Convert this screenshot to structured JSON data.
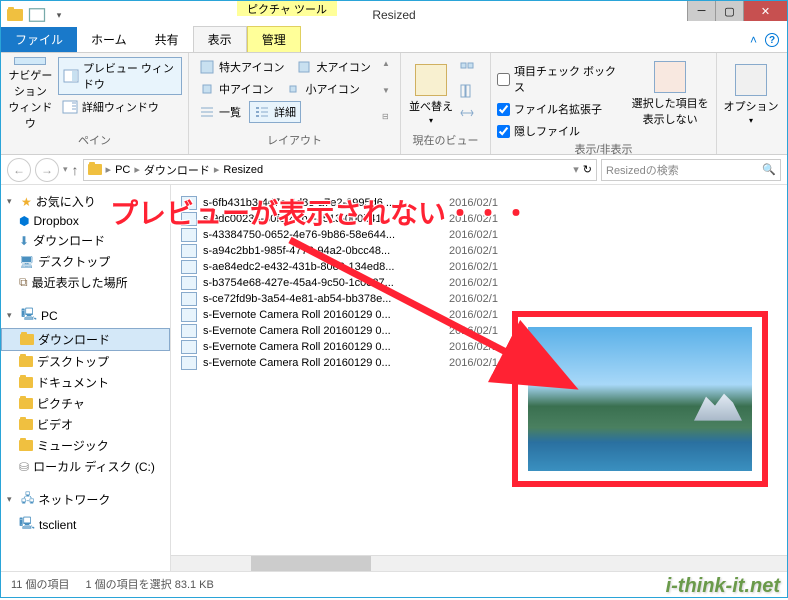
{
  "window": {
    "title": "Resized",
    "context_tab": "ピクチャ ツール"
  },
  "ribbon_tabs": {
    "file": "ファイル",
    "home": "ホーム",
    "share": "共有",
    "view": "表示",
    "manage": "管理"
  },
  "ribbon": {
    "pane": {
      "nav_window": "ナビゲーション\nウィンドウ",
      "preview_window": "プレビュー ウィンドウ",
      "details_window": "詳細ウィンドウ",
      "label": "ペイン"
    },
    "layout": {
      "extra_large": "特大アイコン",
      "large": "大アイコン",
      "medium": "中アイコン",
      "small": "小アイコン",
      "list": "一覧",
      "details": "詳細",
      "label": "レイアウト"
    },
    "current_view": {
      "sort": "並べ替え",
      "label": "現在のビュー"
    },
    "show_hide": {
      "item_checkbox": "項目チェック ボックス",
      "file_ext": "ファイル名拡張子",
      "hidden_files": "隠しファイル",
      "hide_selected": "選択した項目を\n表示しない",
      "label": "表示/非表示"
    },
    "options": {
      "btn": "オプション"
    }
  },
  "breadcrumb": {
    "parts": [
      "PC",
      "ダウンロード",
      "Resized"
    ],
    "refresh": "↻"
  },
  "search": {
    "placeholder": "Resizedの検索"
  },
  "tree": {
    "favorites": "お気に入り",
    "dropbox": "Dropbox",
    "downloads": "ダウンロード",
    "desktop": "デスクトップ",
    "recent": "最近表示した場所",
    "pc": "PC",
    "pc_downloads": "ダウンロード",
    "pc_desktop": "デスクトップ",
    "documents": "ドキュメント",
    "pictures": "ピクチャ",
    "videos": "ビデオ",
    "music": "ミュージック",
    "local_disk": "ローカル ディスク (C:)",
    "network": "ネットワーク",
    "tsclient": "tsclient"
  },
  "files": [
    {
      "name": "s-6fb431b3-4d7e-4d8e-a7e2-8995d6...",
      "date": "2016/02/1"
    },
    {
      "name": "s-9dc00234-80fe-40bc-8513-000b41...",
      "date": "2016/02/1"
    },
    {
      "name": "s-43384750-0652-4e76-9b86-58e644...",
      "date": "2016/02/1"
    },
    {
      "name": "s-a94c2bb1-985f-4776-94a2-0bcc48...",
      "date": "2016/02/1"
    },
    {
      "name": "s-ae84edc2-e432-431b-80e0-134ed8...",
      "date": "2016/02/1"
    },
    {
      "name": "s-b3754e68-427e-45a4-9c50-1c0837...",
      "date": "2016/02/1"
    },
    {
      "name": "s-ce72fd9b-3a54-4e81-ab54-bb378e...",
      "date": "2016/02/1"
    },
    {
      "name": "s-Evernote Camera Roll 20160129 0...",
      "date": "2016/02/1"
    },
    {
      "name": "s-Evernote Camera Roll 20160129 0...",
      "date": "2016/02/1"
    },
    {
      "name": "s-Evernote Camera Roll 20160129 0...",
      "date": "2016/02/1"
    },
    {
      "name": "s-Evernote Camera Roll 20160129 0...",
      "date": "2016/02/1"
    }
  ],
  "status": {
    "item_count": "11 個の項目",
    "selection": "1 個の項目を選択 83.1 KB"
  },
  "callout": "プレビューが表示されない・・・",
  "watermark": "i-think-it.net"
}
